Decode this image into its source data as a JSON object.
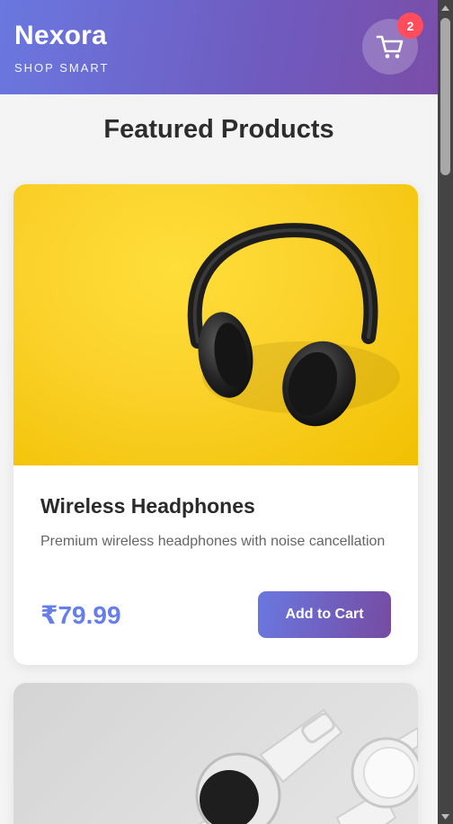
{
  "header": {
    "brand_name": "Nexora",
    "tagline": "SHOP SMART",
    "cart_count": "2",
    "cart_icon": "cart-icon"
  },
  "section": {
    "title": "Featured Products"
  },
  "products": [
    {
      "title": "Wireless Headphones",
      "description": "Premium wireless headphones with noise cancellation",
      "price": "₹79.99",
      "button_label": "Add to Cart",
      "image": "headphones-image"
    },
    {
      "image": "smartwatch-image"
    }
  ],
  "colors": {
    "brand_gradient_start": "#667eea",
    "brand_gradient_end": "#764ba2",
    "badge": "#ff4d5e",
    "price": "#667eea",
    "headphones_background": "#fbd12a"
  }
}
